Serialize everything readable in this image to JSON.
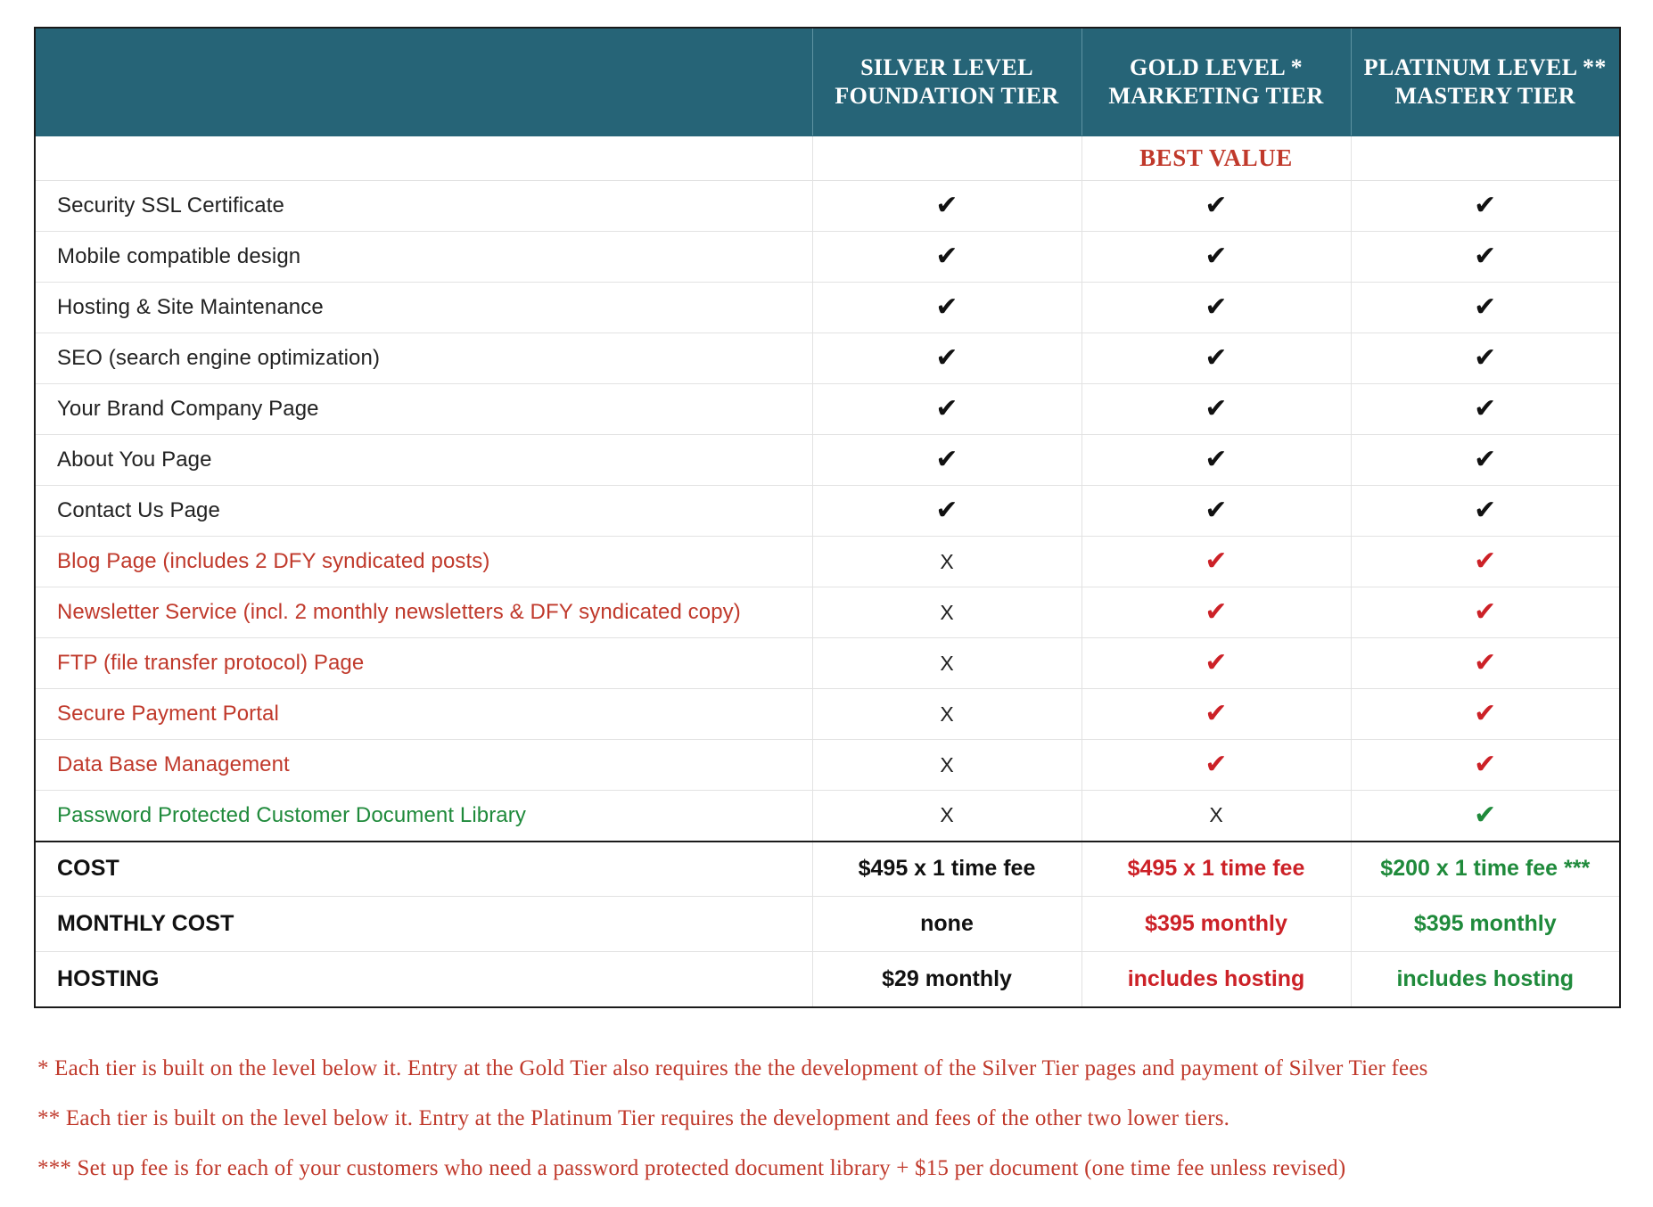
{
  "table": {
    "columns": [
      {
        "id": "feature",
        "label": ""
      },
      {
        "id": "silver",
        "line1": "SILVER LEVEL",
        "line2": "FOUNDATION TIER"
      },
      {
        "id": "gold",
        "line1": "GOLD LEVEL *",
        "line2": "MARKETING TIER"
      },
      {
        "id": "platinum",
        "line1": "PLATINUM LEVEL **",
        "line2": "MASTERY TIER"
      }
    ],
    "tagline": {
      "column": "gold",
      "text": "BEST VALUE"
    },
    "marks": {
      "check": "✔",
      "cross": "X"
    },
    "rows": [
      {
        "feature": "Security SSL Certificate",
        "style": "black",
        "silver": "check",
        "gold": "check",
        "platinum": "check",
        "silver_color": "black",
        "gold_color": "black",
        "platinum_color": "black"
      },
      {
        "feature": "Mobile compatible design",
        "style": "black",
        "silver": "check",
        "gold": "check",
        "platinum": "check",
        "silver_color": "black",
        "gold_color": "black",
        "platinum_color": "black"
      },
      {
        "feature": "Hosting & Site Maintenance",
        "style": "black",
        "silver": "check",
        "gold": "check",
        "platinum": "check",
        "silver_color": "black",
        "gold_color": "black",
        "platinum_color": "black"
      },
      {
        "feature": "SEO (search engine optimization)",
        "style": "black",
        "silver": "check",
        "gold": "check",
        "platinum": "check",
        "silver_color": "black",
        "gold_color": "black",
        "platinum_color": "black"
      },
      {
        "feature": "Your Brand Company Page",
        "style": "black",
        "silver": "check",
        "gold": "check",
        "platinum": "check",
        "silver_color": "black",
        "gold_color": "black",
        "platinum_color": "black"
      },
      {
        "feature": "About You Page",
        "style": "black",
        "silver": "check",
        "gold": "check",
        "platinum": "check",
        "silver_color": "black",
        "gold_color": "black",
        "platinum_color": "black"
      },
      {
        "feature": "Contact Us Page",
        "style": "black",
        "silver": "check",
        "gold": "check",
        "platinum": "check",
        "silver_color": "black",
        "gold_color": "black",
        "platinum_color": "black"
      },
      {
        "feature": "Blog Page (includes 2 DFY syndicated posts)",
        "style": "red",
        "silver": "cross",
        "gold": "check",
        "platinum": "check",
        "silver_color": "black",
        "gold_color": "red",
        "platinum_color": "red"
      },
      {
        "feature": "Newsletter Service (incl. 2 monthly newsletters & DFY syndicated copy)",
        "style": "red",
        "silver": "cross",
        "gold": "check",
        "platinum": "check",
        "silver_color": "black",
        "gold_color": "red",
        "platinum_color": "red"
      },
      {
        "feature": "FTP (file transfer protocol) Page",
        "style": "red",
        "silver": "cross",
        "gold": "check",
        "platinum": "check",
        "silver_color": "black",
        "gold_color": "red",
        "platinum_color": "red"
      },
      {
        "feature": "Secure Payment Portal",
        "style": "red",
        "silver": "cross",
        "gold": "check",
        "platinum": "check",
        "silver_color": "black",
        "gold_color": "red",
        "platinum_color": "red"
      },
      {
        "feature": "Data Base Management",
        "style": "red",
        "silver": "cross",
        "gold": "check",
        "platinum": "check",
        "silver_color": "black",
        "gold_color": "red",
        "platinum_color": "red"
      },
      {
        "feature": "Password Protected Customer Document Library",
        "style": "green",
        "silver": "cross",
        "gold": "cross",
        "platinum": "check",
        "silver_color": "black",
        "gold_color": "black",
        "platinum_color": "green"
      }
    ],
    "cost_rows": [
      {
        "label": "COST",
        "silver": "$495 x 1 time fee",
        "gold": "$495 x 1 time fee",
        "platinum": "$200 x 1 time fee ***"
      },
      {
        "label": "MONTHLY COST",
        "silver": "none",
        "gold": "$395 monthly",
        "platinum": "$395 monthly"
      },
      {
        "label": "HOSTING",
        "silver": "$29 monthly",
        "gold": "includes hosting",
        "platinum": "includes hosting"
      }
    ]
  },
  "footnotes": [
    "* Each tier is built on the level below it. Entry at the Gold Tier also requires the the development of the Silver Tier pages and payment of Silver Tier fees",
    "** Each tier is built on the level below it.  Entry at the Platinum Tier requires the development and fees of the other two lower tiers.",
    "*** Set up fee is for each of your customers who need a password protected document library + $15 per document (one time fee unless revised)"
  ],
  "colors": {
    "header_bg": "#266477",
    "red": "#c0392b",
    "green": "#1f8a3b",
    "black": "#111111"
  }
}
